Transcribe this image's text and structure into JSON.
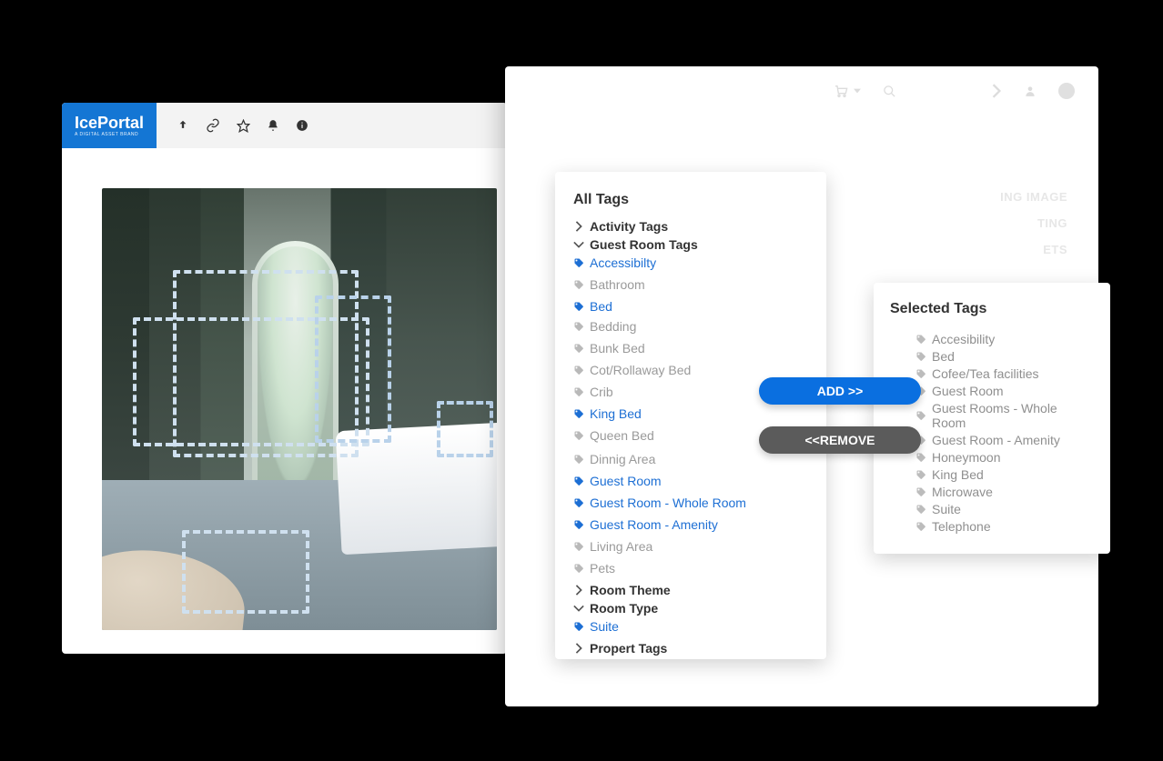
{
  "app": {
    "logo_text": "IcePortal",
    "logo_subtext": "A DIGITAL ASSET BRAND"
  },
  "toolbar_icons": {
    "upload": "upload-icon",
    "link": "link-icon",
    "star": "star-icon",
    "bell": "bell-icon",
    "info": "info-icon"
  },
  "right_panel": {
    "ghost_tabs": [
      "ING IMAGE",
      "TING",
      "ETS"
    ],
    "topbar_icons": [
      "cart-icon",
      "caret-down-icon",
      "search-icon",
      "chevron-right-icon",
      "user-icon",
      "avatar"
    ]
  },
  "all_tags": {
    "title": "All Tags",
    "groups": [
      {
        "id": "activity",
        "label": "Activity Tags",
        "expanded": false
      },
      {
        "id": "guest_room",
        "label": "Guest Room Tags",
        "expanded": true,
        "children": [
          {
            "label": "Accessibilty",
            "selected": true
          },
          {
            "label": "Bathroom",
            "selected": false,
            "dim": true
          },
          {
            "label": "Bed",
            "selected": true,
            "children": [
              {
                "label": "Bedding",
                "selected": false,
                "dim": true
              },
              {
                "label": "Bunk Bed",
                "selected": false,
                "dim": true
              },
              {
                "label": "Cot/Rollaway Bed",
                "selected": false,
                "dim": true
              },
              {
                "label": "Crib",
                "selected": false,
                "dim": true
              },
              {
                "label": "King Bed",
                "selected": true
              },
              {
                "label": "Queen Bed",
                "selected": false,
                "dim": true
              }
            ]
          },
          {
            "label": "Dinnig Area",
            "selected": false,
            "dim": true
          },
          {
            "label": "Guest Room",
            "selected": true
          },
          {
            "label": "Guest Room - Whole Room",
            "selected": true
          },
          {
            "label": "Guest Room - Amenity",
            "selected": true
          },
          {
            "label": "Living Area",
            "selected": false,
            "dim": true
          },
          {
            "label": "Pets",
            "selected": false,
            "dim": true
          }
        ]
      },
      {
        "id": "room_theme",
        "label": "Room Theme",
        "expanded": false
      },
      {
        "id": "room_type",
        "label": "Room Type",
        "expanded": true,
        "children": [
          {
            "label": "Suite",
            "selected": true
          }
        ]
      },
      {
        "id": "property",
        "label": "Propert Tags",
        "expanded": false
      }
    ]
  },
  "buttons": {
    "add": "ADD >>",
    "remove": "<<REMOVE"
  },
  "selected_tags": {
    "title": "Selected Tags",
    "items": [
      "Accesibility",
      "Bed",
      "Cofee/Tea facilities",
      "Guest Room",
      "Guest Rooms - Whole Room",
      "Guest Room - Amenity",
      "Honeymoon",
      "King Bed",
      "Microwave",
      "Suite",
      "Telephone"
    ]
  }
}
